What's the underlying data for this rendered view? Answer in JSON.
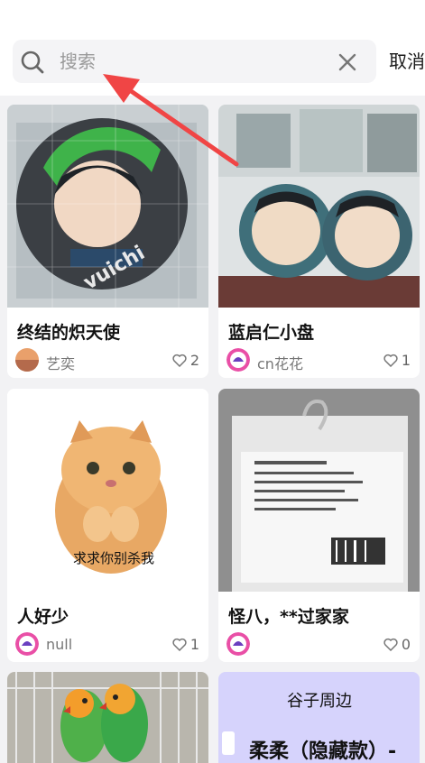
{
  "search": {
    "placeholder": "搜索",
    "cancel_label": "取消"
  },
  "cards": [
    {
      "title": "终结的炽天使",
      "author": "艺奕",
      "likes": "2"
    },
    {
      "title": "蓝启仁小盘",
      "author": "cn花花",
      "likes": "1"
    },
    {
      "title": "人好少",
      "author": "null",
      "likes": "1",
      "image_caption": "求求你别杀我"
    },
    {
      "title": "怪八，**过家家",
      "author": "",
      "likes": "0"
    },
    {
      "title": "",
      "author": "",
      "likes": ""
    },
    {
      "heading": "谷子周边",
      "subtitle": "柔柔（隐藏款）-"
    }
  ],
  "colors": {
    "background": "#f2f2f4",
    "search_field": "#f4f4f6",
    "annotation_arrow": "#f04545",
    "purple_card": "#d6d3fc"
  }
}
